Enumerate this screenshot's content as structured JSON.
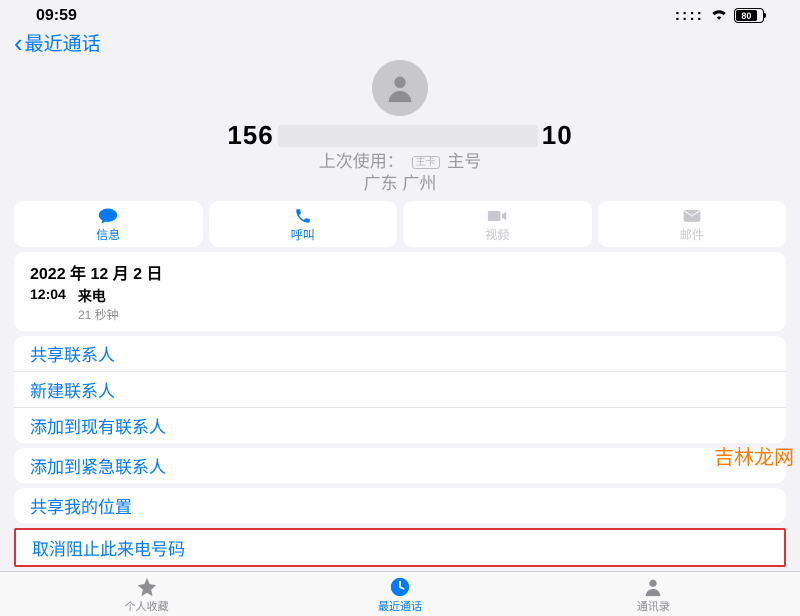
{
  "status": {
    "time": "09:59",
    "battery_pct": "80"
  },
  "nav": {
    "back_label": "最近通话"
  },
  "contact": {
    "phone_prefix": "156",
    "phone_suffix": "10",
    "last_used_label": "上次使用：",
    "sim_badge": "主卡",
    "sim_label": "主号",
    "location": "广东 广州"
  },
  "actions": {
    "message": "信息",
    "call": "呼叫",
    "video": "视频",
    "mail": "邮件"
  },
  "call_log": {
    "date": "2022 年 12 月 2 日",
    "time": "12:04",
    "type": "来电",
    "duration": "21 秒钟"
  },
  "links_group1": [
    "共享联系人",
    "新建联系人",
    "添加到现有联系人"
  ],
  "links_group2": [
    "添加到紧急联系人"
  ],
  "links_group3": [
    "共享我的位置"
  ],
  "unblock": "取消阻止此来电号码",
  "tabs": {
    "favorites": "个人收藏",
    "recents": "最近通话",
    "contacts": "通讯录"
  },
  "watermark": "吉林龙网"
}
